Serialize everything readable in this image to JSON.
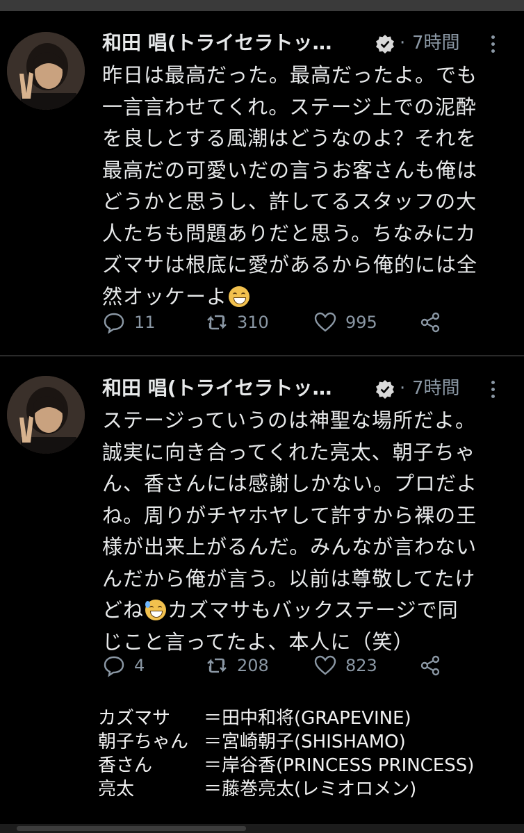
{
  "tweets": [
    {
      "author_name": "和田 唱(トライセラトッ…",
      "separator": "·",
      "time": "7時間",
      "body_lines": [
        "昨日は最高だった。最高だったよ。でも",
        "一言言わせてくれ。ステージ上での泥酔",
        "を良しとする風潮はどうなのよ？それを",
        "最高だの可愛いだの言うお客さんも俺は",
        "どうかと思うし、許してるスタッフの大",
        "人たちも問題ありだと思う。ちなみにカ",
        "ズマサは根底に愛があるから俺的には全",
        "然オッケーよ"
      ],
      "emoji": "grinning-face-emoji",
      "replies": "11",
      "retweets": "310",
      "likes": "995"
    },
    {
      "author_name": "和田 唱(トライセラトッ…",
      "separator": "·",
      "time": "7時間",
      "body_lines": [
        "ステージっていうのは神聖な場所だよ。",
        "誠実に向き合ってくれた亮太、朝子ちゃ",
        "ん、香さんには感謝しかない。プロだよ",
        "ね。周りがチヤホヤして許すから裸の王",
        "様が出来上がるんだ。みんなが言わない",
        "んだから俺が言う。以前は尊敬してたけ",
        "どね",
        "カズマサもバックステージで同",
        "じこと言ってたよ、本人に（笑）"
      ],
      "emoji": "grinning-sweat-emoji",
      "replies": "4",
      "retweets": "208",
      "likes": "823"
    }
  ],
  "notes": [
    {
      "key": "カズマサ",
      "value": "＝田中和将(GRAPEVINE)"
    },
    {
      "key": "朝子ちゃん",
      "value": "＝宮崎朝子(SHISHAMO)"
    },
    {
      "key": "香さん",
      "value": "＝岸谷香(PRINCESS PRINCESS)"
    },
    {
      "key": "亮太",
      "value": "＝藤巻亮太(レミオロメン)"
    }
  ],
  "colors": {
    "background": "#000000",
    "text": "#e7e9ea",
    "muted": "#8b98a5"
  }
}
